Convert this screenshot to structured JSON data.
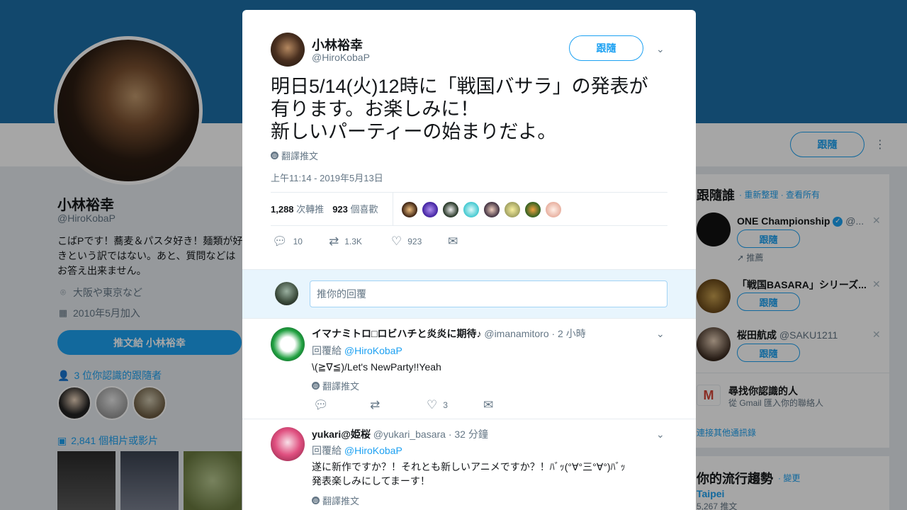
{
  "profile": {
    "name": "小林裕幸",
    "handle": "@HiroKobaP",
    "bio": "こばPです！蕎麦＆パスタ好き！麺類が好きという訳ではない。あと、質問などはお答え出来ません。",
    "location": "大阪や東京など",
    "joined": "2010年5月加入",
    "tweet_to_label": "推文給 小林裕幸",
    "followers_you_know": "3 位你認識的跟隨者",
    "media_label": "2,841 個相片或影片"
  },
  "navbar": {
    "follow_label": "跟隨",
    "more_icon": "vertical-dots-icon"
  },
  "sidebar": {
    "who_to_follow_title": "跟隨誰",
    "refresh_link": "· 重新整理",
    "view_all_link": "· 查看所有",
    "suggestions": [
      {
        "name": "ONE Championship",
        "handle": "@...",
        "follow": "跟隨",
        "meta": "推薦"
      },
      {
        "name": "「戦国BASARA」シリーズ...",
        "handle": "",
        "follow": "跟隨",
        "meta": ""
      },
      {
        "name": "桜田航成",
        "handle": "@SAKU1211",
        "follow": "跟隨",
        "meta": ""
      }
    ],
    "find_friends_title": "尋找你認識的人",
    "find_friends_sub": "從 Gmail 匯入你的聯絡人",
    "connect_other": "連接其他通訊錄",
    "trends_title": "你的流行趨勢",
    "trends_change": "· 變更",
    "trend_location": "Taipei",
    "trend_count": "5,267 推文"
  },
  "tweet": {
    "name": "小林裕幸",
    "handle": "@HiroKobaP",
    "follow_label": "跟隨",
    "text_line1": "明日5/14(火)12時に「戦国バサラ」の発表が",
    "text_line2": "有ります。お楽しみに！",
    "text_line3": "新しいパーティーの始まりだよ。",
    "translate_label": "翻譯推文",
    "timestamp": "上午11:14 - 2019年5月13日",
    "retweets_count": "1,288",
    "retweets_label": "次轉推",
    "likes_count": "923",
    "likes_label": "個喜歡",
    "actions": {
      "reply": "10",
      "retweet": "1.3K",
      "like": "923"
    }
  },
  "reply_box": {
    "placeholder": "推你的回覆"
  },
  "replies": [
    {
      "name": "イマナミトロ□ロビハチと炎炎に期待♪",
      "handle": "@imanamitoro",
      "time": "· 2 小時",
      "reply_to_label": "回覆給",
      "reply_to_handle": "@HiroKobaP",
      "text": "\\(≧∇≦)/Let's NewParty!!Yeah",
      "translate_label": "翻譯推文",
      "likes": "3"
    },
    {
      "name": "yukari@姫桜",
      "handle": "@yukari_basara",
      "time": "· 32 分鐘",
      "reply_to_label": "回覆給",
      "reply_to_handle": "@HiroKobaP",
      "text_line1": "遂に新作ですか？！それとも新しいアニメですか？！ﾊﾞｯ(°∀°三°∀°)ﾊﾞｯ",
      "text_line2": "発表楽しみにしてまーす！",
      "translate_label": "翻譯推文"
    }
  ]
}
